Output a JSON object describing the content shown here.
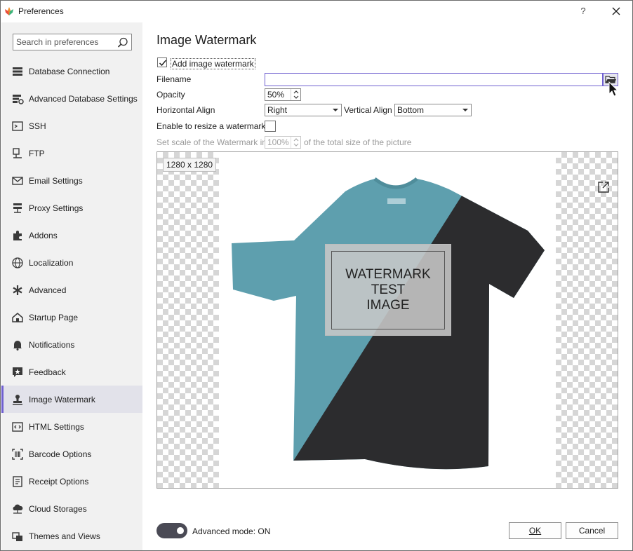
{
  "window": {
    "title": "Preferences",
    "help": "?"
  },
  "sidebar": {
    "search_placeholder": "Search in preferences",
    "items": [
      {
        "label": "Database Connection",
        "icon": "database-icon"
      },
      {
        "label": "Advanced Database Settings",
        "icon": "database-gear-icon"
      },
      {
        "label": "SSH",
        "icon": "terminal-icon"
      },
      {
        "label": "FTP",
        "icon": "network-icon"
      },
      {
        "label": "Email Settings",
        "icon": "envelope-icon"
      },
      {
        "label": "Proxy Settings",
        "icon": "proxy-icon"
      },
      {
        "label": "Addons",
        "icon": "puzzle-icon"
      },
      {
        "label": "Localization",
        "icon": "globe-icon"
      },
      {
        "label": "Advanced",
        "icon": "asterisk-icon"
      },
      {
        "label": "Startup Page",
        "icon": "home-icon"
      },
      {
        "label": "Notifications",
        "icon": "bell-icon"
      },
      {
        "label": "Feedback",
        "icon": "star-comment-icon"
      },
      {
        "label": "Image Watermark",
        "icon": "stamp-icon",
        "active": true
      },
      {
        "label": "HTML Settings",
        "icon": "code-icon"
      },
      {
        "label": "Barcode Options",
        "icon": "barcode-icon"
      },
      {
        "label": "Receipt Options",
        "icon": "receipt-icon"
      },
      {
        "label": "Cloud Storages",
        "icon": "cloud-icon"
      },
      {
        "label": "Themes and Views",
        "icon": "palette-icon"
      }
    ]
  },
  "main": {
    "title": "Image Watermark",
    "add_watermark_label": "Add image watermark",
    "add_watermark_checked": true,
    "filename_label": "Filename",
    "filename_value": "",
    "opacity_label": "Opacity",
    "opacity_value": "50%",
    "halign_label": "Horizontal Align",
    "halign_value": "Right",
    "valign_label": "Vertical Align",
    "valign_value": "Bottom",
    "resize_label": "Enable to resize a watermark",
    "resize_checked": false,
    "scale_label_prefix": "Set scale of the Watermark in",
    "scale_value": "100%",
    "scale_label_suffix": "of the total size of the picture",
    "preview": {
      "size_label": "1280 x 1280",
      "watermark_lines": [
        "WATERMARK",
        "TEST",
        "IMAGE"
      ],
      "shirt_colors": {
        "light": "#5e9fae",
        "dark": "#2c2c2e"
      }
    }
  },
  "footer": {
    "advanced_mode_label": "Advanced mode: ON",
    "advanced_mode_on": true,
    "ok_label": "OK",
    "cancel_label": "Cancel"
  },
  "colors": {
    "accent": "#6f5fd0",
    "sidebar_bg": "#f1f1f1",
    "active_bg": "#e2e2ea"
  }
}
